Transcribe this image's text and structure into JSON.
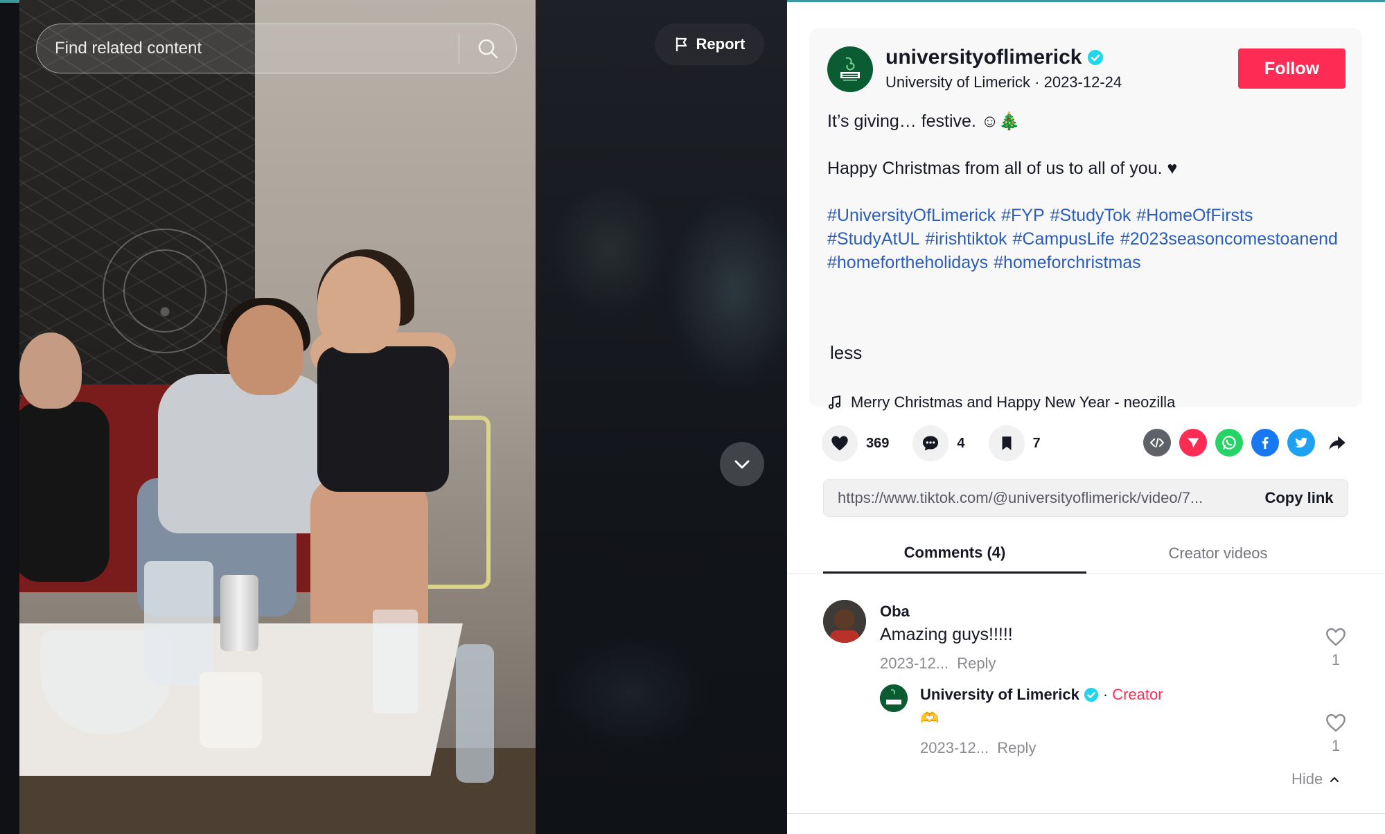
{
  "search": {
    "placeholder": "Find related content"
  },
  "video": {
    "report_label": "Report"
  },
  "post": {
    "author_username": "universityoflimerick",
    "author_display": "University of Limerick",
    "date": "2023-12-24",
    "author_sub": "University of Limerick · 2023-12-24",
    "follow_label": "Follow",
    "caption_line1": "It’s giving… festive. ☺🎄",
    "caption_line2": "Happy Christmas from all of us to all of you. ♥",
    "hashtags": [
      "#UniversityOfLimerick",
      "#FYP",
      "#StudyTok",
      "#HomeOfFirsts",
      "#StudyAtUL",
      "#irishtiktok",
      "#CampusLife",
      "#2023seasoncomestoanend",
      "#homefortheholidays",
      "#homeforchristmas"
    ],
    "less_label": "less",
    "music": "Merry Christmas and Happy New Year - neozilla"
  },
  "actions": {
    "likes": "369",
    "comments": "4",
    "saves": "7"
  },
  "share": {
    "icons": [
      "embed-icon",
      "send-to-friends-icon",
      "whatsapp-icon",
      "facebook-icon",
      "twitter-icon",
      "share-arrow-icon"
    ],
    "colors": {
      "embed": "#5f6168",
      "send": "#fe2c55",
      "whatsapp": "#25d366",
      "facebook": "#1877f2",
      "twitter": "#1da1f2"
    }
  },
  "link": {
    "url": "https://www.tiktok.com/@universityoflimerick/video/7...",
    "copy_label": "Copy link"
  },
  "tabs": [
    {
      "label": "Comments (4)",
      "active": true
    },
    {
      "label": "Creator videos",
      "active": false
    }
  ],
  "comments": [
    {
      "user": "Oba",
      "text": "Amazing guys!!!!!",
      "date": "2023-12...",
      "reply_label": "Reply",
      "likes": "1"
    }
  ],
  "replies": [
    {
      "user": "University of Limerick",
      "creator_label": "Creator",
      "text": "🫶",
      "date": "2023-12...",
      "reply_label": "Reply",
      "likes": "1"
    }
  ],
  "hide_label": "Hide",
  "colors": {
    "accent": "#fe2c55",
    "hashtag": "#2b5db9",
    "verified": "#20d5ec",
    "brand_green": "#0b5b33"
  }
}
